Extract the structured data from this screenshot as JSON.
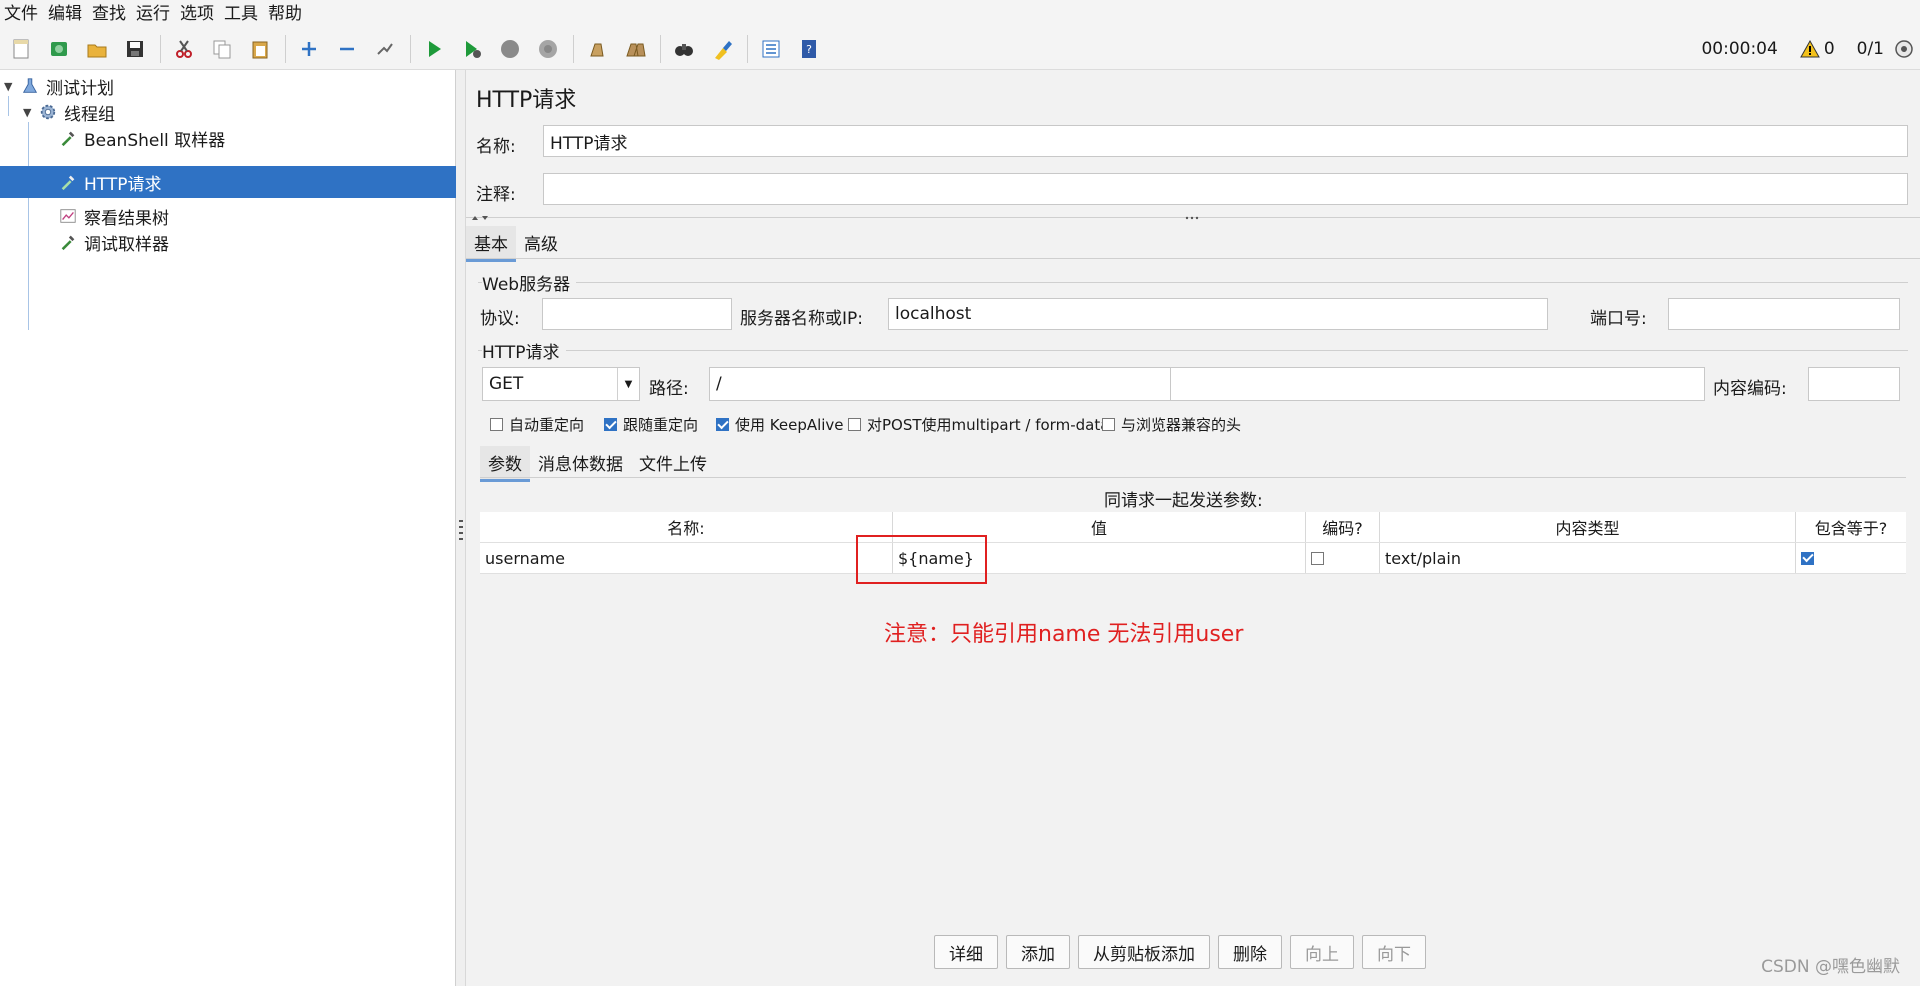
{
  "menu": [
    "文件",
    "编辑",
    "查找",
    "运行",
    "选项",
    "工具",
    "帮助"
  ],
  "toolbar": {
    "timer": "00:00:04",
    "warnings": "0",
    "threads": "0/1"
  },
  "tree": {
    "plan": "测试计划",
    "group": "线程组",
    "items": [
      "BeanShell 取样器",
      "HTTP请求",
      "察看结果树",
      "调试取样器"
    ]
  },
  "panel": {
    "title": "HTTP请求",
    "name_label": "名称:",
    "name_value": "HTTP请求",
    "comment_label": "注释:",
    "comment_value": "",
    "tabs": [
      "基本",
      "高级"
    ]
  },
  "web_server": {
    "section": "Web服务器",
    "protocol_label": "协议:",
    "protocol_value": "",
    "server_label": "服务器名称或IP:",
    "server_value": "localhost",
    "port_label": "端口号:",
    "port_value": ""
  },
  "http_request": {
    "section": "HTTP请求",
    "method": "GET",
    "path_label": "路径:",
    "path_value": "/",
    "encoding_label": "内容编码:",
    "encoding_value": "",
    "checkboxes": [
      {
        "label": "自动重定向",
        "checked": false
      },
      {
        "label": "跟随重定向",
        "checked": true
      },
      {
        "label": "使用 KeepAlive",
        "checked": true
      },
      {
        "label": "对POST使用multipart / form-data",
        "checked": false
      },
      {
        "label": "与浏览器兼容的头",
        "checked": false
      }
    ],
    "subtabs": [
      "参数",
      "消息体数据",
      "文件上传"
    ]
  },
  "params": {
    "caption": "同请求一起发送参数:",
    "headers": [
      "名称:",
      "值",
      "编码?",
      "内容类型",
      "包含等于?"
    ],
    "rows": [
      {
        "name": "username",
        "value": "${name}",
        "encode": false,
        "content_type": "text/plain",
        "include_equals": true
      }
    ]
  },
  "annotation": "注意：只能引用name 无法引用user",
  "buttons": [
    "详细",
    "添加",
    "从剪贴板添加",
    "删除",
    "向上",
    "向下"
  ],
  "watermark": "CSDN @嘿色幽默"
}
